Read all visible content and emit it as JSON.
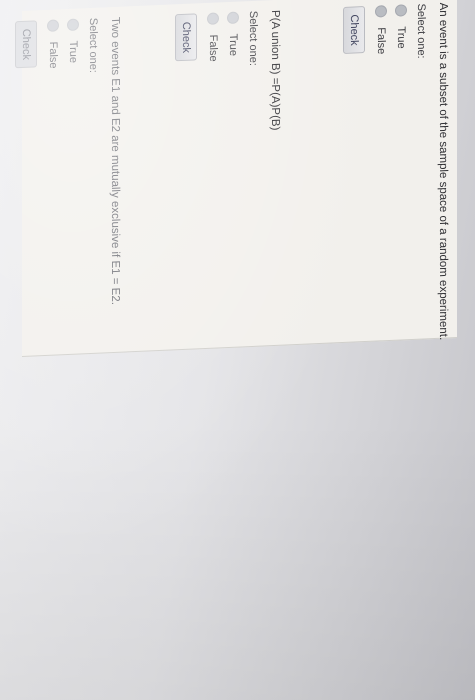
{
  "questions": [
    {
      "text": "An event is a subset of the sample space of a random experiment.",
      "select_label": "Select one:",
      "options": [
        "True",
        "False"
      ],
      "check_label": "Check"
    },
    {
      "text": "P(A union B) =P(A)P(B)",
      "select_label": "Select one:",
      "options": [
        "True",
        "False"
      ],
      "check_label": "Check"
    },
    {
      "text": "Two events E1 and E2 are mutually exclusive if E1 = E2.",
      "select_label": "Select one:",
      "options": [
        "True",
        "False"
      ],
      "check_label": "Check"
    }
  ]
}
